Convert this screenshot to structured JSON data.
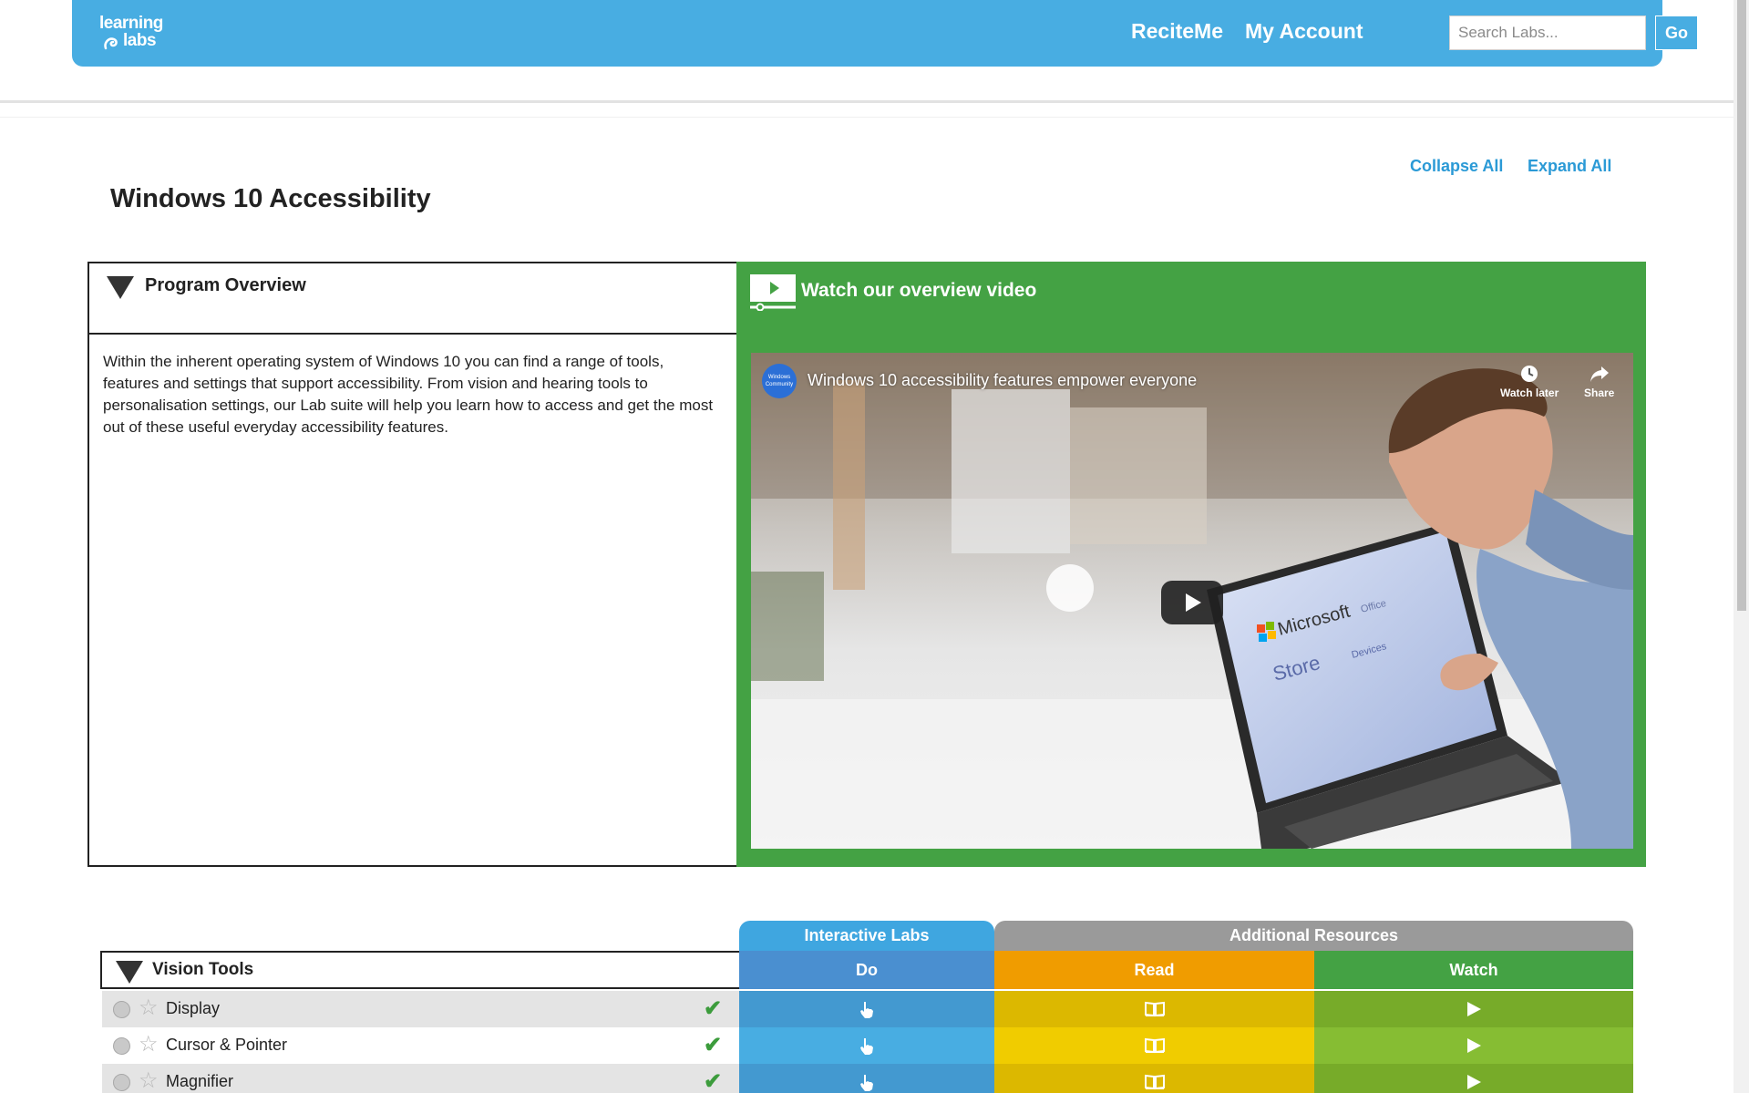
{
  "header": {
    "logo_line1": "learning",
    "logo_line2": "labs",
    "nav": {
      "reciteme": "ReciteMe",
      "my_account": "My Account"
    },
    "search": {
      "placeholder": "Search Labs...",
      "value": ""
    },
    "go_label": "Go",
    "color": "#48ade2"
  },
  "toolbar": {
    "collapse_all": "Collapse All",
    "expand_all": "Expand All"
  },
  "page_title": "Windows 10 Accessibility",
  "overview": {
    "title": "Program Overview",
    "text": "Within the inherent operating system of Windows 10 you can find a range of tools, features and settings that support accessibility. From vision and hearing tools to personalisation settings, our Lab suite will help you learn how to access and get the most out of these useful everyday accessibility features.",
    "video_heading": "Watch our overview video",
    "video": {
      "channel_avatar_text": "Windows Community",
      "title": "Windows 10 accessibility features empower everyone",
      "watch_later": "Watch later",
      "share": "Share",
      "screen_brand": "Microsoft",
      "screen_office": "Office",
      "screen_store": "Store",
      "screen_devices": "Devices"
    },
    "panel_color": "#44a244"
  },
  "table": {
    "group_headers": {
      "interactive_labs": "Interactive Labs",
      "additional_resources": "Additional Resources"
    },
    "columns": {
      "do": "Do",
      "read": "Read",
      "watch": "Watch"
    },
    "section_title": "Vision Tools",
    "rows": [
      {
        "label": "Display",
        "completed": true
      },
      {
        "label": "Cursor & Pointer",
        "completed": true
      },
      {
        "label": "Magnifier",
        "completed": true
      }
    ],
    "colors": {
      "do": "#4a8fd0",
      "read": "#f09c00",
      "watch": "#44a244",
      "additional": "#9a9a9a",
      "interactive": "#3fa6e0"
    }
  }
}
